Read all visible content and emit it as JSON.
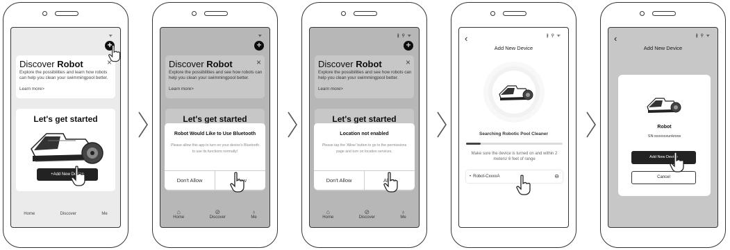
{
  "status": {
    "wifi_only": "ᯤ",
    "full": "∦ ⚲ ᯤ"
  },
  "discover": {
    "title_prefix": "Discover",
    "title_bold": "Robot",
    "text_s1": "Explore the possibilities and learn how robots can help you clean your swimmingpool better.",
    "text_s2": "Explore the possibilities and see how robots can help you clean your swimmingpool better.",
    "learn_more": "Learn more>",
    "close": "×"
  },
  "start": {
    "title": "Let's get started",
    "title_obscured": "Let's get started",
    "add_button": "+Add New Device"
  },
  "tabs": {
    "home": "Home",
    "discover": "Discover",
    "me": "Me"
  },
  "bluetooth_dialog": {
    "title": "Robot Would Like to Use Bluetooth",
    "body": "Please allow this app to turn on your device's Bluetooth to use its functions normally!",
    "deny": "Don't Allow",
    "allow": "Allow"
  },
  "location_dialog": {
    "title": "Location not enabled",
    "body": "Please tap the 'Allow' button to go to the permissions page and turn on location services.",
    "deny": "Don't Allow",
    "allow": "Allow"
  },
  "add_device": {
    "back": "‹",
    "title": "Add New Device",
    "searching": "Searching Robotic Pool Cleaner",
    "hint": "Make sure the device is turned on and within 2 meters/ 6 feet of range",
    "device_name": "Robot-CxxxxA",
    "progress": 0.15
  },
  "device_card": {
    "name": "Robot",
    "sn": "SN:xxxxxxxunknow",
    "add_button": "Add New Device",
    "cancel_button": "Cancel"
  },
  "icons": {
    "plus": "+",
    "home": "⌂",
    "discover": "⊘",
    "me": "♁",
    "link": "⊖",
    "bullet": "•",
    "chevron": "chevron-right-icon",
    "hand": "hand-pointer-icon"
  }
}
